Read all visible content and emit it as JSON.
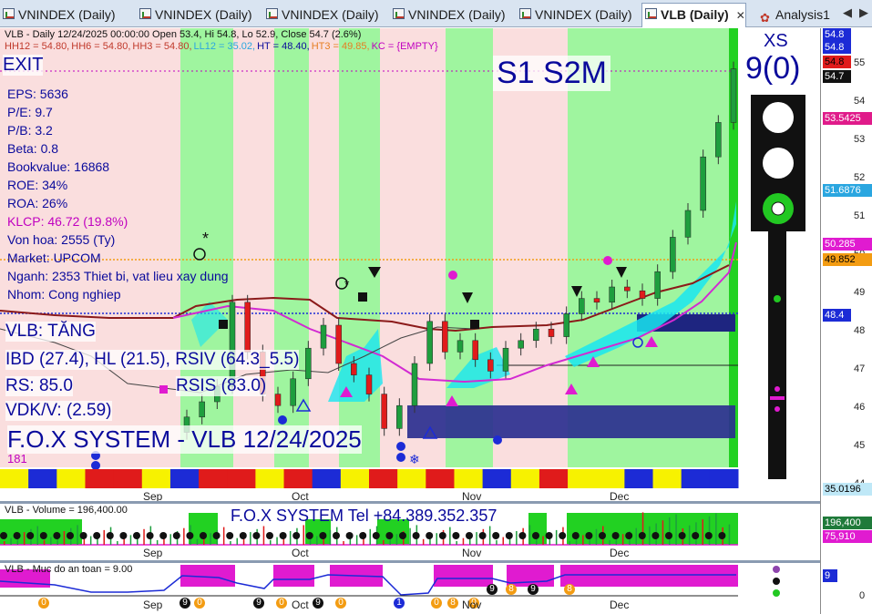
{
  "tabs": [
    {
      "label": "VNINDEX (Daily)"
    },
    {
      "label": "VNINDEX (Daily)"
    },
    {
      "label": "VNINDEX (Daily)"
    },
    {
      "label": "VNINDEX (Daily)"
    },
    {
      "label": "VNINDEX (Daily)"
    },
    {
      "label": "VLB (Daily)",
      "close": "✕"
    },
    {
      "label": "Analysis1"
    }
  ],
  "nav": {
    "prev": "◀",
    "next": "▶"
  },
  "price_pane": {
    "header": "VLB - Daily 12/24/2025 00:00:00 Open 53.4, Hi 54.8, Lo 52.9, Close 54.7 (2.6%)",
    "indicators": [
      {
        "text": "HH12 = 54.80,",
        "color": "#c0392b"
      },
      {
        "text": "HH6 = 54.80,",
        "color": "#c0392b"
      },
      {
        "text": "HH3 = 54.80,",
        "color": "#c0392b"
      },
      {
        "text": "LL12 = 35.02,",
        "color": "#2aa6e0"
      },
      {
        "text": "HT = 48.40,",
        "color": "#0a0a9c"
      },
      {
        "text": "HT3 = 49.85,",
        "color": "#e67e22"
      },
      {
        "text": "KC = {EMPTY}",
        "color": "#c000c0"
      }
    ],
    "exit_label": "EXIT",
    "signal_title": "S1 S2M",
    "fundamentals": [
      {
        "text": "EPS: 5636",
        "color": "#0a0a9c"
      },
      {
        "text": "P/E: 9.7",
        "color": "#0a0a9c"
      },
      {
        "text": "P/B: 3.2",
        "color": "#0a0a9c"
      },
      {
        "text": "Beta: 0.8",
        "color": "#0a0a9c"
      },
      {
        "text": "Bookvalue: 16868",
        "color": "#0a0a9c"
      },
      {
        "text": "ROE: 34%",
        "color": "#0a0a9c"
      },
      {
        "text": "ROA: 26%",
        "color": "#0a0a9c"
      },
      {
        "text": "KLCP: 46.72 (19.8%)",
        "color": "#c000c0"
      },
      {
        "text": "Von hoa: 2555 (Ty)",
        "color": "#0a0a9c"
      },
      {
        "text": "Market: UPCOM",
        "color": "#0a0a9c"
      },
      {
        "text": "Nganh: 2353 Thiet bi, vat lieu xay dung",
        "color": "#0a0a9c"
      },
      {
        "text": "Nhom: Cong nghiep",
        "color": "#0a0a9c"
      }
    ],
    "trend_label": "VLB: TĂNG",
    "ibd_line": "IBD (27.4), HL (21.5), RSIV (64.3_5.5)",
    "rs_label": "RS: 85.0",
    "rsis_label": "RSIS (83.0)",
    "vdk_label": "VDK/V:  (2.59)",
    "system_title": "F.O.X SYSTEM - VLB 12/24/2025",
    "bottom_count": "181",
    "xs_label": "XS",
    "xs_value": "9(0)",
    "axis_ticks": [
      "55",
      "54",
      "53",
      "52",
      "51",
      "50",
      "49",
      "48",
      "47",
      "46",
      "45",
      "44"
    ],
    "price_tags": [
      {
        "text": "54.8",
        "bg": "#1c2bd6",
        "fg": "#ffffff"
      },
      {
        "text": "54.8",
        "bg": "#1c2bd6",
        "fg": "#ffffff"
      },
      {
        "text": "54.8",
        "bg": "#e01b1b",
        "fg": "#000000"
      },
      {
        "text": "54.7",
        "bg": "#111111",
        "fg": "#ffffff"
      },
      {
        "text": "53.5425",
        "bg": "#e01b8a",
        "fg": "#ffffff"
      },
      {
        "text": "51.6876",
        "bg": "#2aa6e0",
        "fg": "#ffffff"
      },
      {
        "text": "50.285",
        "bg": "#e01bd0",
        "fg": "#ffffff"
      },
      {
        "text": "49.852",
        "bg": "#f39c12",
        "fg": "#000000"
      },
      {
        "text": "48.4",
        "bg": "#1c2bd6",
        "fg": "#ffffff"
      },
      {
        "text": "35.0196",
        "bg": "#bfe8f7",
        "fg": "#000000"
      }
    ],
    "months": [
      "Sep",
      "Oct",
      "Nov",
      "Dec"
    ]
  },
  "volume_pane": {
    "header": "VLB - Volume = 196,400.00",
    "title": "F.O.X SYSTEM Tel +84.389.352.357",
    "tags": [
      {
        "text": "196,400",
        "bg": "#1f7a3a",
        "fg": "#ffffff"
      },
      {
        "text": "75,910",
        "bg": "#e01bd0",
        "fg": "#ffffff"
      }
    ],
    "months": [
      "Sep",
      "Oct",
      "Nov",
      "Dec"
    ]
  },
  "safety_pane": {
    "header": "VLB - Muc do an toan = 9.00",
    "tags": [
      {
        "text": "9",
        "bg": "#1c2bd6",
        "fg": "#ffffff"
      }
    ],
    "axis_zero": "0",
    "months": [
      "Sep",
      "Oct",
      "Nov",
      "Dec"
    ],
    "markers": [
      "0",
      "9",
      "0",
      "9",
      "0",
      "9",
      "0",
      "1",
      "0",
      "8",
      "0",
      "9",
      "8",
      "9",
      "8",
      "8"
    ]
  },
  "chart_data": {
    "type": "candlestick",
    "title": "VLB - Daily 12/24/2025",
    "x": [
      "Sep",
      "Oct",
      "Nov",
      "Dec"
    ],
    "ylim": [
      44,
      55.5
    ],
    "series": [
      {
        "name": "Close",
        "values": [
          45.6,
          46.0,
          46.4,
          48.6,
          47.3,
          46.2,
          45.9,
          46.6,
          47.4,
          48.0,
          47.0,
          46.7,
          46.2,
          45.3,
          45.9,
          47.0,
          48.1,
          47.3,
          47.6,
          47.1,
          46.8,
          47.4,
          47.6,
          47.9,
          47.7,
          48.3,
          48.7,
          48.6,
          49.0,
          48.9,
          48.7,
          49.4,
          50.3,
          51.0,
          52.4,
          53.3,
          54.7
        ]
      },
      {
        "name": "HT",
        "values": [
          48.4
        ]
      }
    ]
  }
}
